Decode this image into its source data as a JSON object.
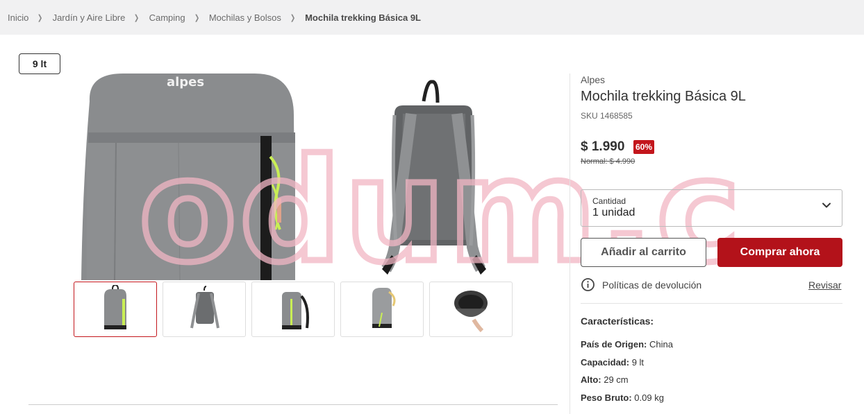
{
  "breadcrumb": {
    "items": [
      "Inicio",
      "Jardín y Aire Libre",
      "Camping",
      "Mochilas y Bolsos"
    ],
    "current": "Mochila trekking Básica 9L"
  },
  "size_badge": "9 lt",
  "gallery": {
    "main_logo_text": "alpes",
    "thumbnails": [
      "front-view",
      "back-view",
      "side-view",
      "side-detail-view",
      "open-view"
    ],
    "active_index": 0
  },
  "watermark_text": "odum.cl",
  "product": {
    "brand": "Alpes",
    "title": "Mochila trekking Básica 9L",
    "sku": "SKU 1468585",
    "price": "$ 1.990",
    "discount": "60%",
    "normal_price": "Normal: $ 4.990"
  },
  "quantity": {
    "label": "Cantidad",
    "value": "1 unidad"
  },
  "buttons": {
    "add_to_cart": "Añadir al carrito",
    "buy_now": "Comprar ahora"
  },
  "returns": {
    "label": "Políticas de devolución",
    "link": "Revisar"
  },
  "specs": {
    "title": "Características:",
    "rows": [
      {
        "key": "País de Origen:",
        "value": "China"
      },
      {
        "key": "Capacidad:",
        "value": "9 lt"
      },
      {
        "key": "Alto:",
        "value": "29 cm"
      },
      {
        "key": "Peso Bruto:",
        "value": "0.09 kg"
      }
    ]
  },
  "colors": {
    "accent": "#b3121a",
    "discount_badge": "#c3161c",
    "watermark": "#f2b6c4"
  },
  "icons": [
    "chevron-right-icon",
    "chevron-down-icon",
    "info-circle-icon"
  ]
}
